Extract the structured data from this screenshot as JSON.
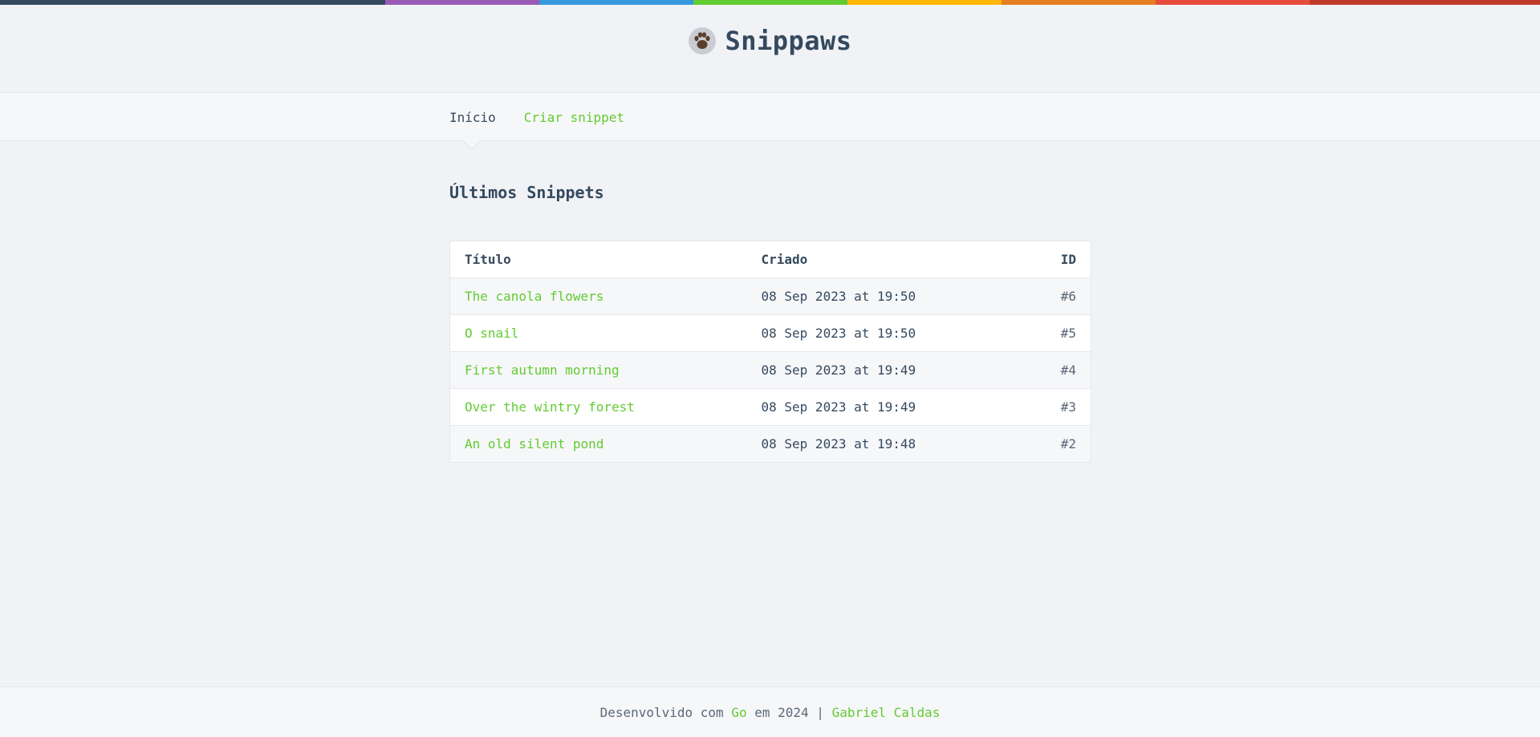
{
  "theme": {
    "accent": "#62cb31",
    "text": "#34495e",
    "background": "#f0f2f6",
    "rainbow": [
      "#34495e",
      "#9b59b6",
      "#3498db",
      "#62cb31",
      "#ffb606",
      "#e67e22",
      "#e74c3c",
      "#c0392b"
    ]
  },
  "header": {
    "logo_icon": "paw-icon",
    "brand": "Snippaws"
  },
  "nav": {
    "home_label": "Início",
    "create_label": "Criar snippet"
  },
  "main": {
    "title": "Últimos Snippets",
    "table": {
      "headers": {
        "title": "Título",
        "created": "Criado",
        "id": "ID"
      },
      "rows": [
        {
          "title": "The canola flowers",
          "created": "08 Sep 2023 at 19:50",
          "id": "#6"
        },
        {
          "title": "O snail",
          "created": "08 Sep 2023 at 19:50",
          "id": "#5"
        },
        {
          "title": "First autumn morning",
          "created": "08 Sep 2023 at 19:49",
          "id": "#4"
        },
        {
          "title": "Over the wintry forest",
          "created": "08 Sep 2023 at 19:49",
          "id": "#3"
        },
        {
          "title": "An old silent pond",
          "created": "08 Sep 2023 at 19:48",
          "id": "#2"
        }
      ]
    }
  },
  "footer": {
    "prefix": "Desenvolvido com ",
    "lang_link": "Go",
    "middle": " em 2024 | ",
    "author_link": "Gabriel Caldas"
  }
}
